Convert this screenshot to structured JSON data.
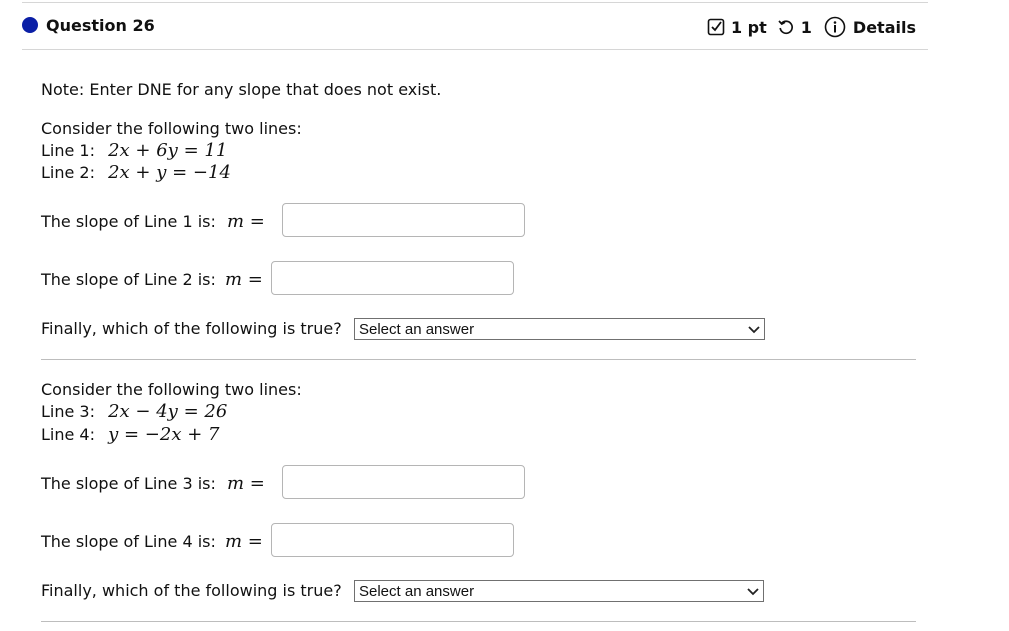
{
  "header": {
    "question_title": "Question 26",
    "points": "1 pt",
    "attempts": "1",
    "details_label": "Details",
    "accent_color": "#0b1fa6"
  },
  "note": "Note: Enter DNE for any slope that does not exist.",
  "part1": {
    "intro": "Consider the following two lines:",
    "line_a_label": "Line 1:",
    "line_b_label": "Line 2:",
    "slope_a_label": "The slope of Line 1 is:",
    "slope_b_label": "The slope of Line 2 is:",
    "m_label": "m =",
    "question": "Finally, which of the following is true?",
    "select_value": "Select an answer"
  },
  "part2": {
    "intro": "Consider the following two lines:",
    "line_a_label": "Line 3:",
    "line_b_label": "Line 4:",
    "slope_a_label": "The slope of Line 3 is:",
    "slope_b_label": "The slope of Line 4 is:",
    "m_label": "m =",
    "question": "Finally, which of the following is true?",
    "select_value": "Select an answer"
  },
  "equations": {
    "line1": "2x + 6y = 11",
    "line2": "2x + y = −14",
    "line3": "2x − 4y = 26",
    "line4": "y = −2x + 7"
  }
}
